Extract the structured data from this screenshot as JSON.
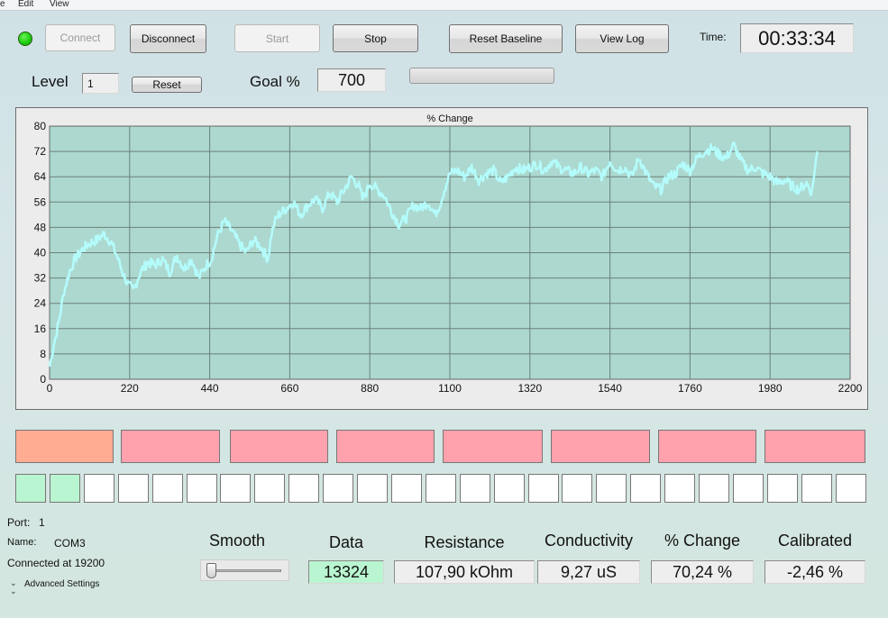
{
  "menu": {
    "items": [
      "e",
      "Edit",
      "View"
    ]
  },
  "toolbar": {
    "connect_label": "Connect",
    "disconnect_label": "Disconnect",
    "start_label": "Start",
    "stop_label": "Stop",
    "reset_baseline_label": "Reset Baseline",
    "view_log_label": "View Log",
    "time_label": "Time:",
    "time_value": "00:33:34",
    "status_led_color": "#1fcd10"
  },
  "level": {
    "label": "Level",
    "value": "1",
    "reset_label": "Reset",
    "goal_label": "Goal %",
    "goal_value": "700",
    "goal_progress": 0
  },
  "chart_data": {
    "type": "line",
    "title": "% Change",
    "xlabel": "",
    "ylabel": "",
    "xlim": [
      0,
      2200
    ],
    "ylim": [
      0,
      80
    ],
    "x_ticks": [
      0,
      220,
      440,
      660,
      880,
      1100,
      1320,
      1540,
      1760,
      1980,
      2200
    ],
    "y_ticks": [
      0,
      8,
      16,
      24,
      32,
      40,
      48,
      56,
      64,
      72,
      80
    ],
    "grid": true,
    "line_color": "#b4fbfb",
    "plot_background": "#acd8cf",
    "series": [
      {
        "x": [
          0,
          10,
          25,
          40,
          55,
          70,
          90,
          110,
          130,
          150,
          170,
          185,
          200,
          215,
          230,
          250,
          270,
          290,
          310,
          330,
          350,
          370,
          390,
          410,
          430,
          445,
          460,
          480,
          500,
          520,
          540,
          560,
          580,
          600,
          610,
          620,
          630,
          650,
          670,
          690,
          710,
          730,
          750,
          770,
          790,
          810,
          830,
          850,
          860,
          870,
          880,
          900,
          920,
          940,
          960,
          980,
          1000,
          1020,
          1040,
          1060,
          1075,
          1085,
          1100,
          1120,
          1140,
          1160,
          1180,
          1200,
          1220,
          1240,
          1260,
          1280,
          1300,
          1320,
          1340,
          1360,
          1380,
          1400,
          1420,
          1440,
          1460,
          1480,
          1500,
          1520,
          1540,
          1560,
          1580,
          1600,
          1620,
          1640,
          1660,
          1680,
          1700,
          1720,
          1740,
          1760,
          1780,
          1800,
          1820,
          1840,
          1860,
          1880,
          1900,
          1920,
          1940,
          1960,
          1980,
          2000,
          2020,
          2040,
          2060,
          2080,
          2095,
          2100,
          2110
        ],
        "y": [
          4,
          10,
          18,
          28,
          34,
          38,
          41,
          43,
          44,
          46,
          43,
          39,
          34,
          30,
          28,
          34,
          37,
          36,
          38,
          34,
          39,
          35,
          38,
          32,
          36,
          38,
          45,
          50,
          47,
          43,
          40,
          44,
          42,
          38,
          46,
          50,
          52,
          54,
          56,
          52,
          55,
          57,
          54,
          59,
          56,
          60,
          64,
          61,
          57,
          59,
          62,
          60,
          58,
          53,
          49,
          51,
          55,
          54,
          56,
          52,
          56,
          60,
          65,
          66,
          64,
          67,
          63,
          65,
          66,
          62,
          64,
          67,
          66,
          67,
          68,
          66,
          69,
          67,
          66,
          65,
          67,
          65,
          66,
          64,
          69,
          66,
          67,
          64,
          70,
          65,
          61,
          60,
          64,
          65,
          68,
          66,
          70,
          72,
          73,
          71,
          70,
          74,
          69,
          66,
          67,
          65,
          64,
          62,
          63,
          61,
          60,
          62,
          59,
          64,
          72
        ]
      }
    ]
  },
  "indicators": {
    "tile_colors": [
      "#ffac92",
      "#ffa2ad",
      "#ffa2ad",
      "#ffa2ad",
      "#ffa2ad",
      "#ffa2ad",
      "#ffa2ad",
      "#ffa2ad"
    ],
    "squares_on": [
      true,
      true,
      false,
      false,
      false,
      false,
      false,
      false,
      false,
      false,
      false,
      false,
      false,
      false,
      false,
      false,
      false,
      false,
      false,
      false,
      false,
      false,
      false,
      false,
      false
    ]
  },
  "status": {
    "port_label": "Port:",
    "port_value": "1",
    "name_label": "Name:",
    "name_value": "COM3",
    "connection_text": "Connected at 19200",
    "advanced_label": "Advanced Settings"
  },
  "smooth": {
    "label": "Smooth",
    "value": 0
  },
  "metrics": [
    {
      "label": "Data",
      "value": "13324",
      "highlight": "#b9f5d0"
    },
    {
      "label": "Resistance",
      "value": "107,90 kOhm"
    },
    {
      "label": "Conductivity",
      "value": "9,27 uS"
    },
    {
      "label": "% Change",
      "value": "70,24 %"
    },
    {
      "label": "Calibrated",
      "value": "-2,46 %"
    }
  ]
}
